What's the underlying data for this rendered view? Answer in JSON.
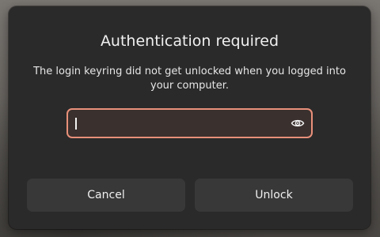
{
  "dialog": {
    "title": "Authentication required",
    "message": "The login keyring did not get unlocked when you logged into your computer.",
    "password": {
      "value": "",
      "placeholder": "",
      "reveal_icon": "eye-icon",
      "border_color": "#e8907a"
    },
    "buttons": {
      "cancel_label": "Cancel",
      "unlock_label": "Unlock"
    }
  },
  "colors": {
    "dialog_bg": "#2a2a2a",
    "button_bg": "#383838",
    "text": "#f0f0f0",
    "accent": "#e8907a"
  }
}
